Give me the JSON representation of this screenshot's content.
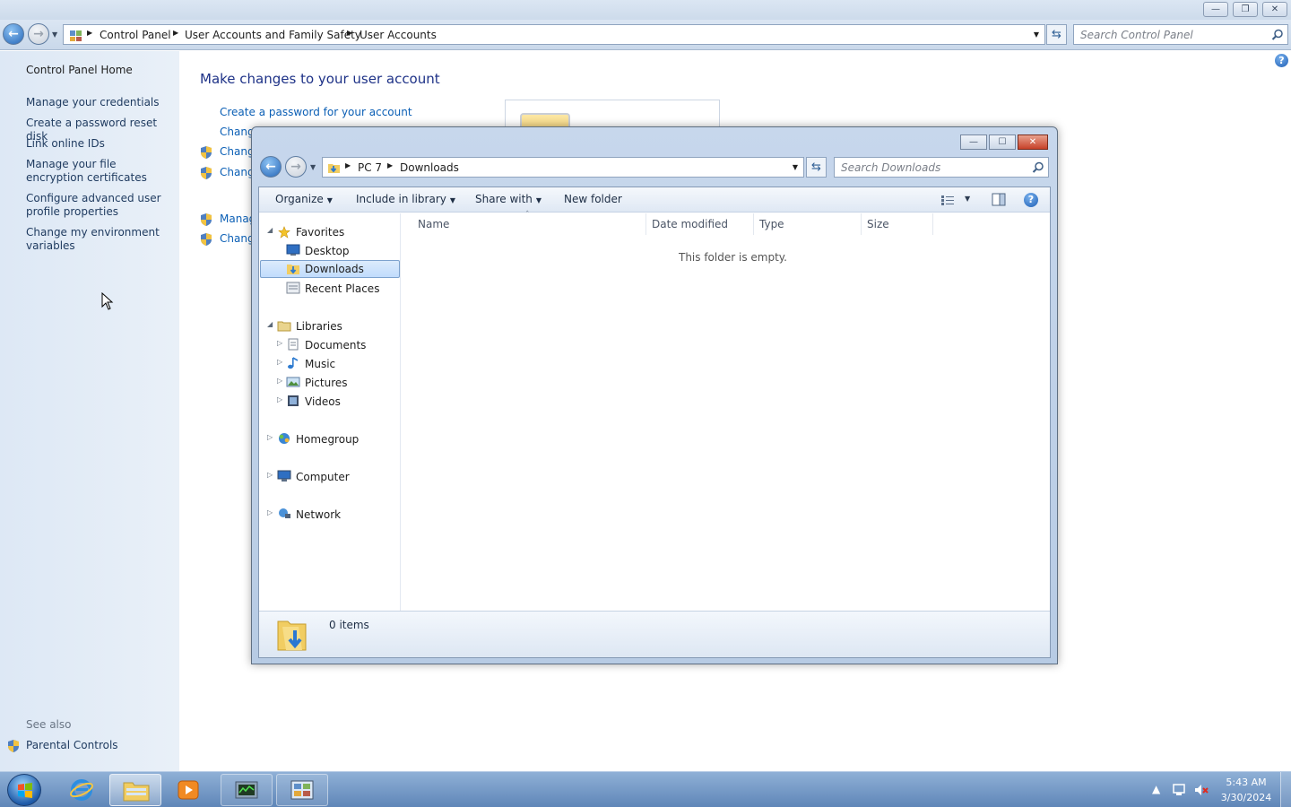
{
  "control_panel": {
    "breadcrumb": [
      "Control Panel",
      "User Accounts and Family Safety",
      "User Accounts"
    ],
    "search_placeholder": "Search Control Panel",
    "window_buttons": {
      "minimize": "—",
      "restore": "❐",
      "close": "✕"
    },
    "left_nav": {
      "home": "Control Panel Home",
      "links": [
        "Manage your credentials",
        "Create a password reset disk",
        "Link online IDs",
        "Manage your file encryption certificates",
        "Configure advanced user profile properties",
        "Change my environment variables"
      ],
      "see_also_label": "See also",
      "see_also": [
        "Parental Controls"
      ]
    },
    "heading": "Make changes to your user account",
    "tasks": [
      "Create a password for your account",
      "Chang",
      "Chang",
      "Chang",
      "Manag",
      "Chang"
    ]
  },
  "explorer": {
    "breadcrumb": [
      "PC 7",
      "Downloads"
    ],
    "search_placeholder": "Search Downloads",
    "toolbar": {
      "organize": "Organize",
      "include_in_library": "Include in library",
      "share_with": "Share with",
      "new_folder": "New folder"
    },
    "nav_tree": {
      "favorites": {
        "label": "Favorites",
        "items": [
          "Desktop",
          "Downloads",
          "Recent Places"
        ],
        "selected": "Downloads"
      },
      "libraries": {
        "label": "Libraries",
        "items": [
          "Documents",
          "Music",
          "Pictures",
          "Videos"
        ]
      },
      "homegroup": "Homegroup",
      "computer": "Computer",
      "network": "Network"
    },
    "columns": [
      "Name",
      "Date modified",
      "Type",
      "Size"
    ],
    "empty_message": "This folder is empty.",
    "status": "0 items"
  },
  "taskbar": {
    "apps": [
      "internet-explorer",
      "windows-explorer",
      "media-player",
      "task-manager",
      "control-panel"
    ],
    "time": "5:43 AM",
    "date": "3/30/2024"
  },
  "colors": {
    "link": "#0b5fb5",
    "heading": "#1e3287",
    "nav_bg": "#dde8f5",
    "selection": "#c1dcfc"
  }
}
